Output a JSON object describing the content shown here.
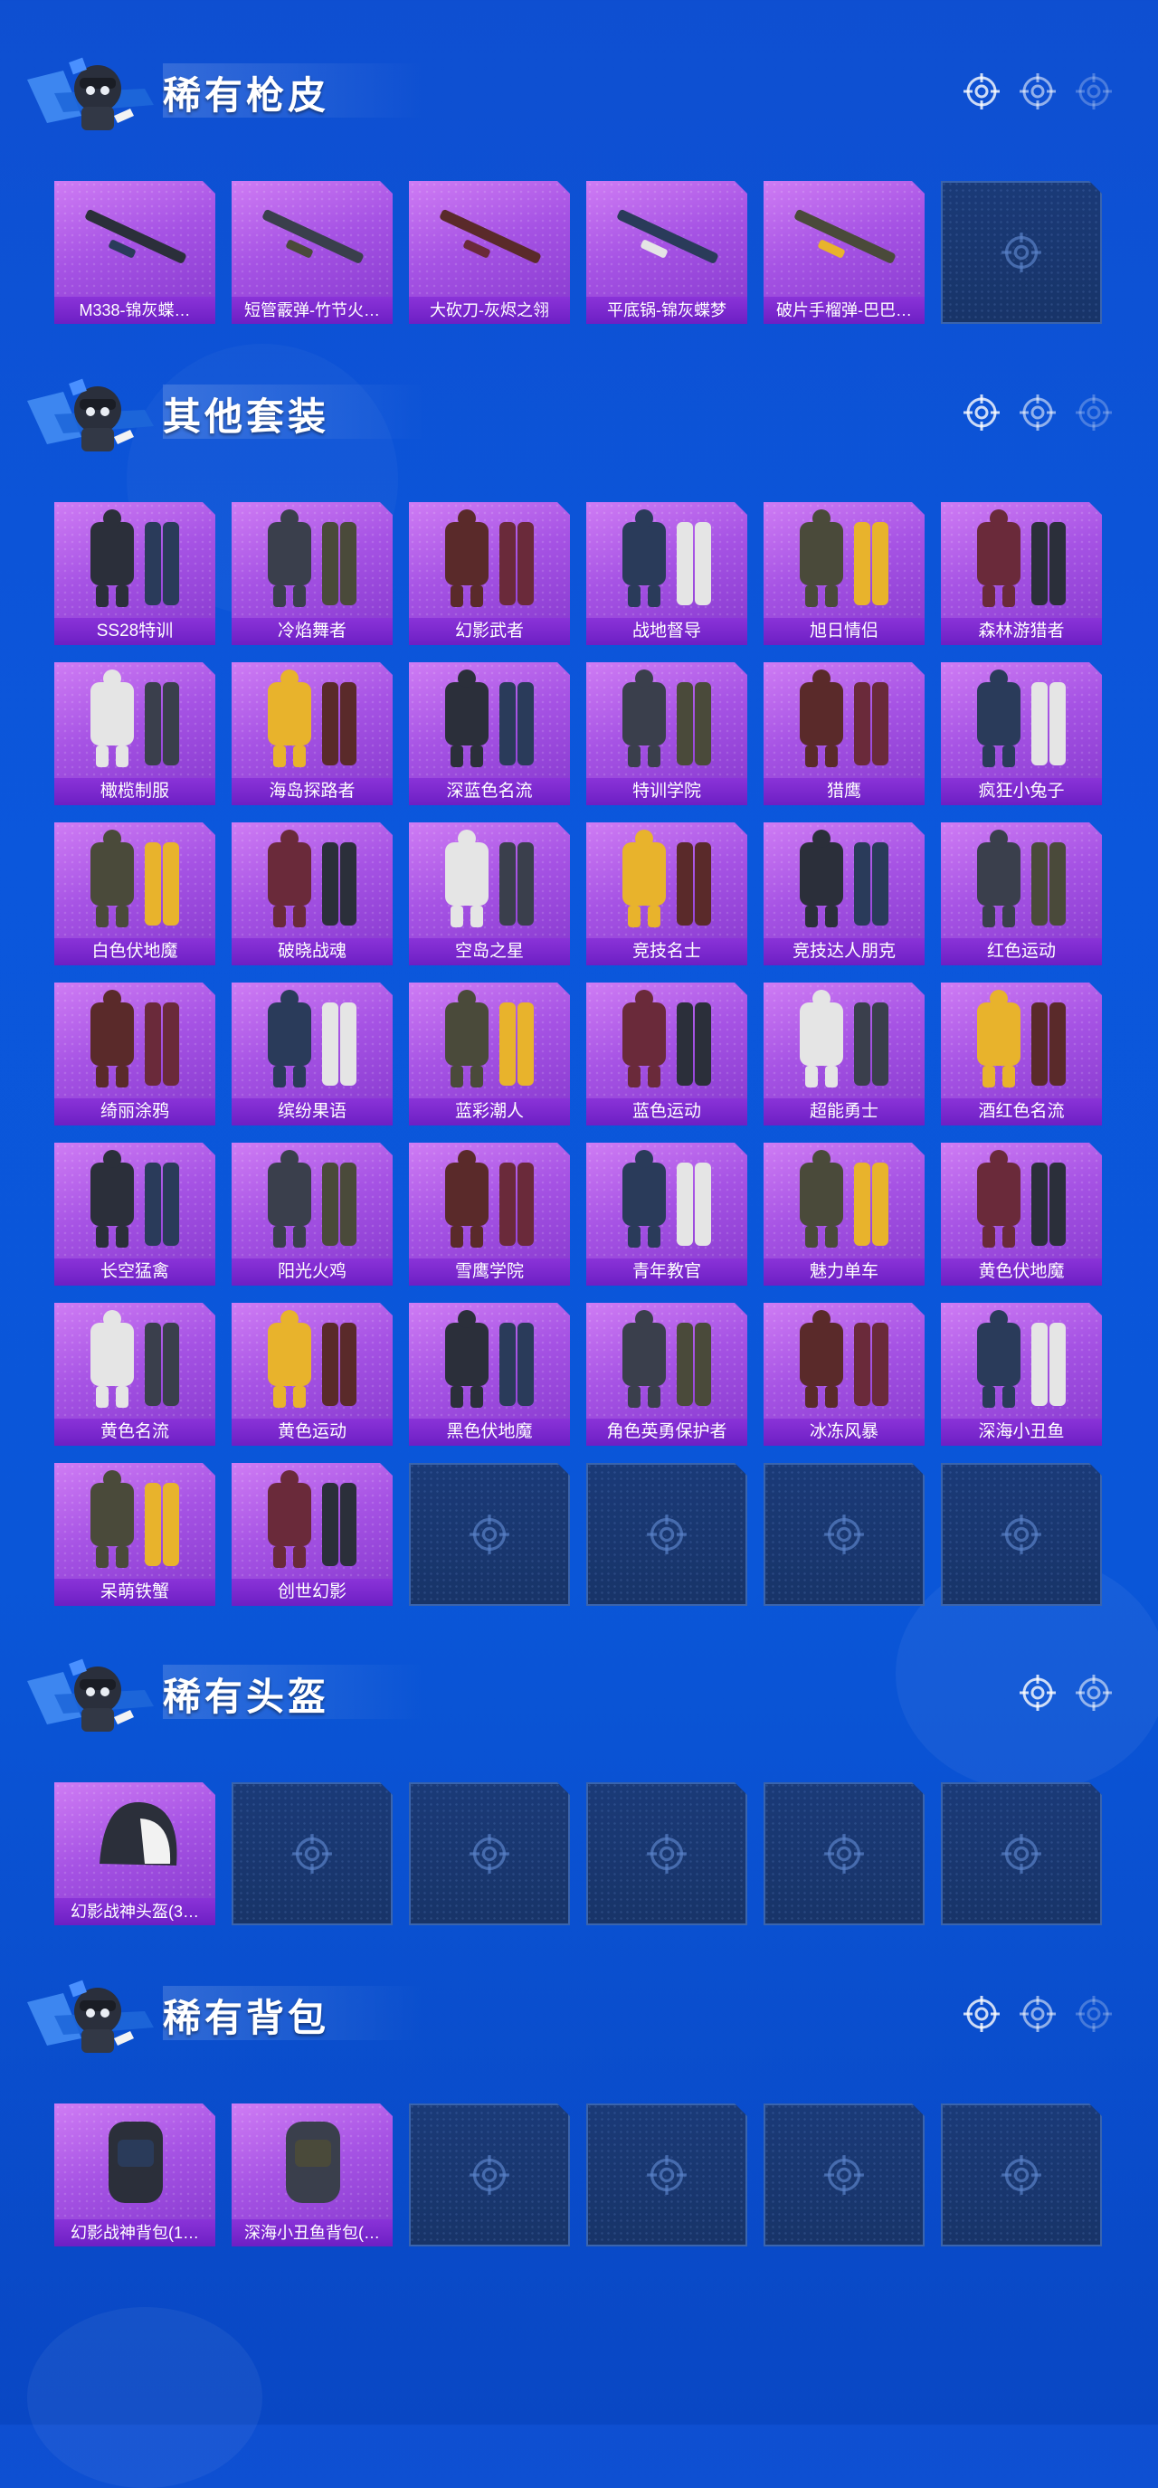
{
  "sections": {
    "gun": {
      "title": "稀有枪皮",
      "items": [
        "M338-锦灰蝶…",
        "短管霰弹-竹节火…",
        "大砍刀-灰烬之翎",
        "平底锅-锦灰蝶梦",
        "破片手榴弹-巴巴…"
      ]
    },
    "outfit": {
      "title": "其他套装",
      "items": [
        "SS28特训",
        "冷焰舞者",
        "幻影武者",
        "战地督导",
        "旭日情侣",
        "森林游猎者",
        "橄榄制服",
        "海岛探路者",
        "深蓝色名流",
        "特训学院",
        "猎鹰",
        "疯狂小兔子",
        "白色伏地魔",
        "破晓战魂",
        "空岛之星",
        "竞技名士",
        "竞技达人朋克",
        "红色运动",
        "绮丽涂鸦",
        "缤纷果语",
        "蓝彩潮人",
        "蓝色运动",
        "超能勇士",
        "酒红色名流",
        "长空猛禽",
        "阳光火鸡",
        "雪鹰学院",
        "青年教官",
        "魅力单车",
        "黄色伏地魔",
        "黄色名流",
        "黄色运动",
        "黑色伏地魔",
        "角色英勇保护者",
        "冰冻风暴",
        "深海小丑鱼",
        "呆萌铁蟹",
        "创世幻影"
      ]
    },
    "helmet": {
      "title": "稀有头盔",
      "items": [
        "幻影战神头盔(3…"
      ]
    },
    "backpack": {
      "title": "稀有背包",
      "items": [
        "幻影战神背包(1…",
        "深海小丑鱼背包(…"
      ]
    }
  },
  "icons": {
    "header_emblem": "soldier-mascot-icon",
    "header_decor": "crosshair-icon",
    "empty_slot": "crosshair-icon"
  },
  "colors": {
    "background": "#0b57dc",
    "tile_purple": "#a653e4",
    "label_purple": "#6d1fc4",
    "empty_slot": "#183468"
  }
}
